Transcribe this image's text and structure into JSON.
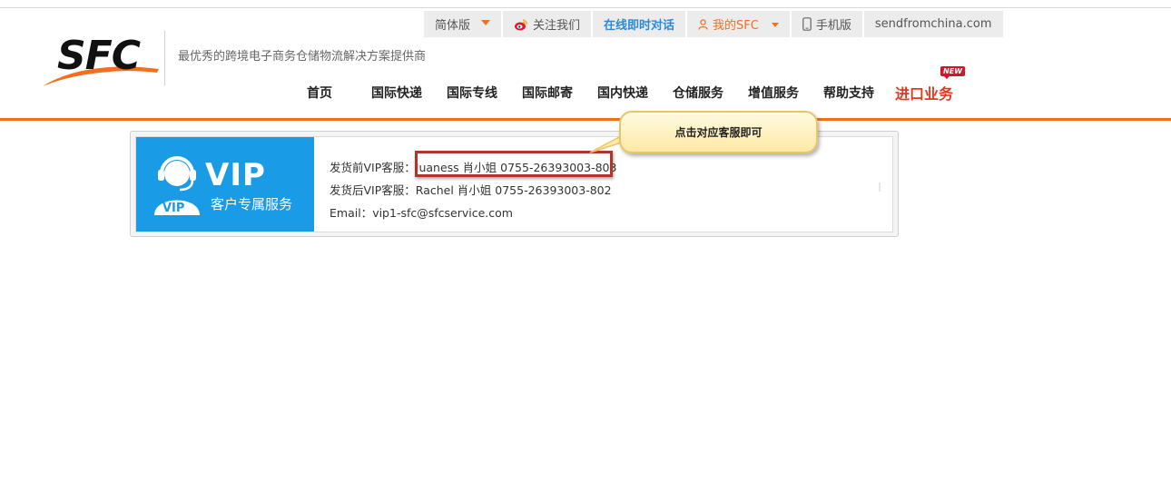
{
  "topbar": {
    "lang": "简体版",
    "follow": "关注我们",
    "chat": "在线即时对话",
    "my_sfc": "我的SFC",
    "mobile": "手机版",
    "domain": "sendfromchina.com"
  },
  "brand": {
    "logo_text": "SFC",
    "slogan": "最优秀的跨境电子商务仓储物流解决方案提供商",
    "accent": "#f07020",
    "blue": "#1a9be5"
  },
  "nav": {
    "items": [
      "首页",
      "国际快递",
      "国际专线",
      "国际邮寄",
      "国内快递",
      "仓储服务",
      "增值服务",
      "帮助支持"
    ],
    "special": "进口业务",
    "badge": "NEW"
  },
  "vip": {
    "title": "VIP",
    "subtitle": "客户专属服务",
    "icon_label": "VIP",
    "pre_label": "发货前VIP客服：",
    "pre_value": "Juaness 肖小姐  0755-26393003-803",
    "post_label": "发货后VIP客服：",
    "post_value": "Rachel 肖小姐  0755-26393003-802",
    "email_label": "Email：",
    "email_value": "vip1-sfc@sfcservice.com"
  },
  "callout": {
    "text": "点击对应客服即可"
  }
}
